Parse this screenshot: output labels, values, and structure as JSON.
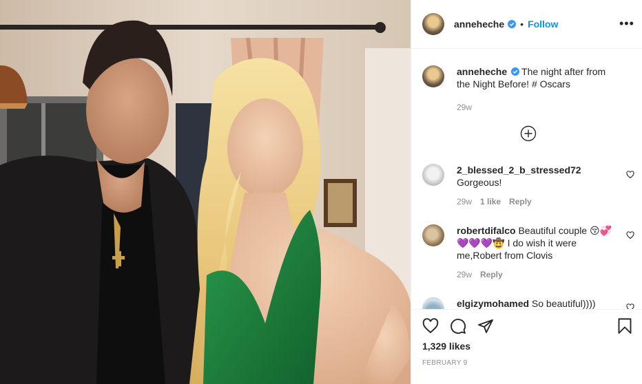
{
  "header": {
    "username": "anneheche",
    "separator": "•",
    "follow_label": "Follow",
    "more_label": "•••"
  },
  "caption": {
    "username": "anneheche",
    "text": "The night after from the Night Before! # Oscars",
    "time": "29w"
  },
  "comments": [
    {
      "username": "2_blessed_2_b_stressed72",
      "text": "Gorgeous!",
      "time": "29w",
      "likes": "1 like",
      "reply": "Reply"
    },
    {
      "username": "robertdifalco",
      "text": "Beautiful couple 😚💞💜💜💜🤠 I do wish it were me,Robert from Clovis",
      "time": "29w",
      "reply": "Reply"
    },
    {
      "username": "elgizymohamed",
      "text": "So beautiful))))"
    }
  ],
  "actions": {
    "likes": "1,329 likes",
    "date": "FEBRUARY 9"
  },
  "colors": {
    "link": "#0095f6",
    "muted": "#8e8e8e",
    "text": "#262626",
    "dress": "#1f7a3c"
  }
}
